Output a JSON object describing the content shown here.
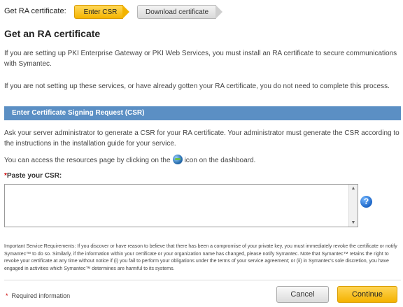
{
  "wizard": {
    "label": "Get RA certificate:",
    "steps": [
      {
        "label": "Enter CSR",
        "state": "active"
      },
      {
        "label": "Download certificate",
        "state": "inactive"
      }
    ]
  },
  "page": {
    "title": "Get an RA certificate",
    "intro_1": "If you are setting up PKI Enterprise Gateway or PKI Web Services, you must install an RA certificate to secure communications with Symantec.",
    "intro_2": "If you are not setting up these services, or have already gotten your RA certificate, you do not need to complete this process."
  },
  "section": {
    "title": "Enter Certificate Signing Request (CSR)",
    "instructions": "Ask your server administrator to generate a CSR for your RA certificate. Your administrator must generate the CSR according to the instructions in the installation guide for your service.",
    "resources_before": "You can access the resources page by clicking on the",
    "resources_after": "icon on the dashboard.",
    "resources_icon": "globe-icon"
  },
  "csr": {
    "required_mark": "*",
    "label": "Paste your CSR:",
    "value": "",
    "help_icon": "question-mark-icon",
    "help_glyph": "?"
  },
  "fine_print": "Important Service Requirements: If you discover or have reason to believe that there has been a compromise of your private key, you must immediately revoke the certificate or notify Symantec™ to do so. Similarly, if the information within your certificate or your organization name has changed, please notify Symantec. Note that Symantec™ retains the right to revoke your certificate at any time without notice if (i) you fail to perform your obligations under the terms of your service agreement; or (ii) in Symantec's sole discretion, you have engaged in activities which Symantec™ determines are harmful to its systems.",
  "footer": {
    "required_mark": "*",
    "required_note": "Required information",
    "cancel_label": "Cancel",
    "continue_label": "Continue"
  },
  "colors": {
    "accent": "#f5b400",
    "section_bar": "#5b8fc4",
    "required": "#cc0000"
  }
}
